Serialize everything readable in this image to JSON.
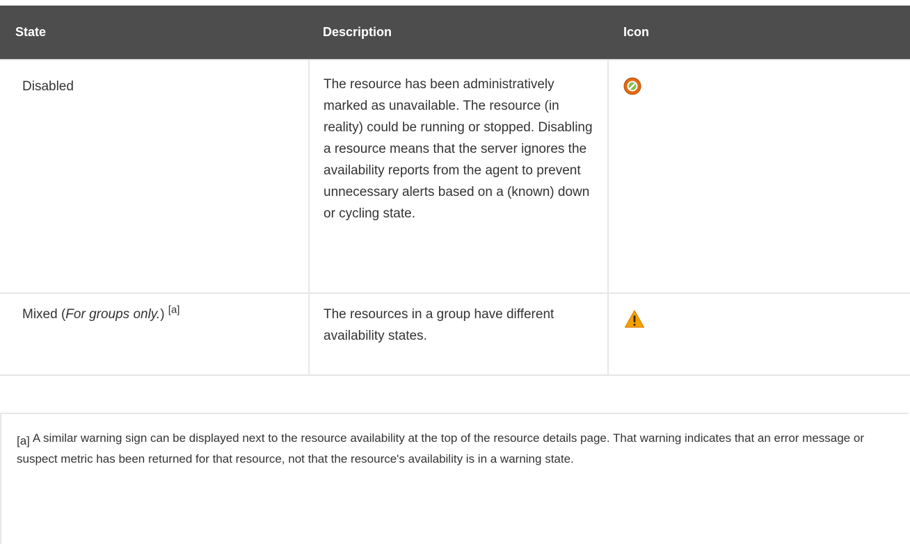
{
  "table": {
    "headers": {
      "state": "State",
      "description": "Description",
      "icon": "Icon"
    },
    "rows": [
      {
        "state": "Disabled",
        "description": "The resource has been administratively marked as unavailable. The resource (in reality) could be running or stopped. Disabling a resource means that the server ignores the availability reports from the agent to prevent unnecessary alerts based on a (known) down or cycling state.",
        "icon": "disabled-icon"
      },
      {
        "state": "Mixed (",
        "state_italic": "For groups only.",
        "state_after": ")",
        "footnote_ref": "[a]",
        "description": "The resources in a group have different availability states.",
        "icon": "warning-icon"
      }
    ]
  },
  "footnote": {
    "mark": "[a]",
    "text": "A similar warning sign can be displayed next to the resource availability at the top of the resource details page. That warning indicates that an error message or suspect metric has been returned for that resource, not that the resource's availability is in a warning state."
  },
  "colors": {
    "header_bg": "#4d4d4d",
    "border": "#e6e6e6",
    "disabled_icon": "#e36a12",
    "warning_icon": "#f5a100"
  }
}
